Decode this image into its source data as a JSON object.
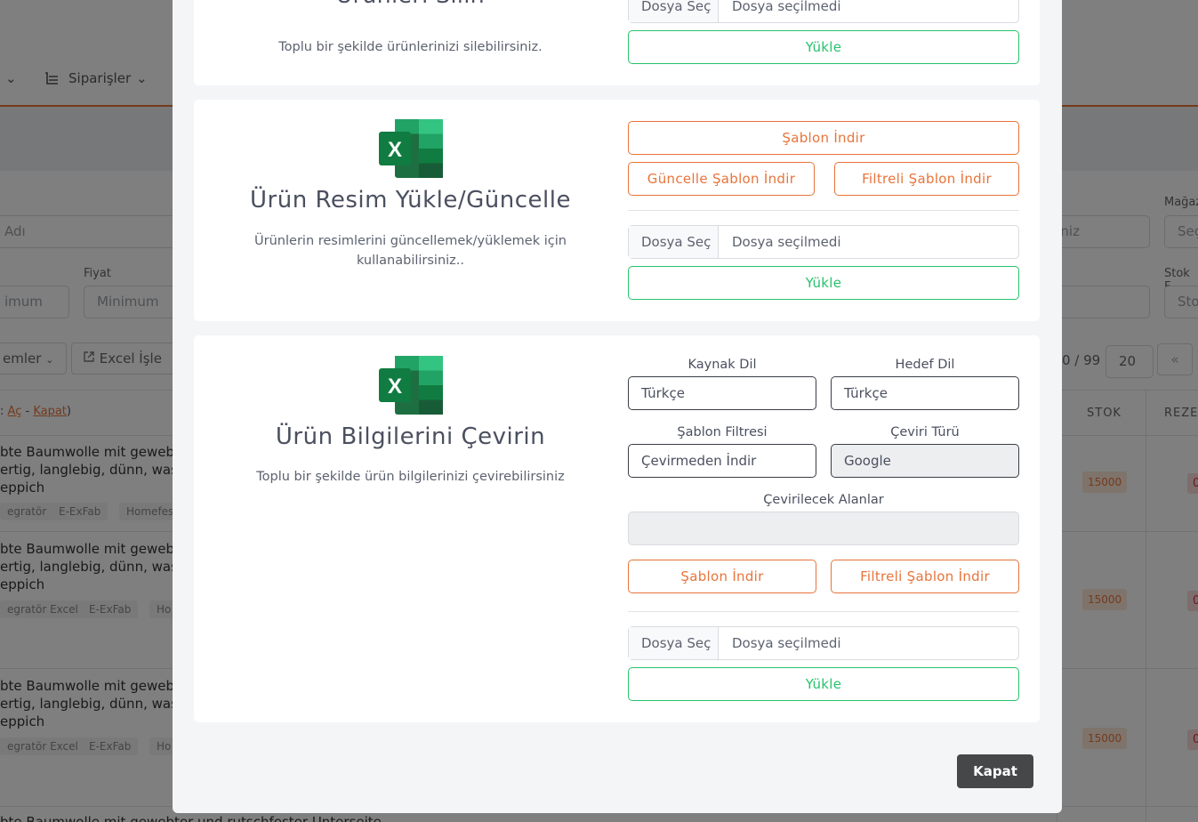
{
  "background": {
    "nav": {
      "orders_label": "Siparişler"
    },
    "filters": {
      "name_placeholder": "Adı",
      "price_label": "Fiyat",
      "min_placeholder_1": "imum",
      "min_placeholder_2": "Minimum",
      "right_placeholder": "çiniz",
      "store_label": "Mağaz",
      "store_value": "Seç",
      "stock_label": "Stok F",
      "stock_value": "Sto"
    },
    "toolbar": {
      "bulk_label": "emler",
      "excel_label": "Excel İşle",
      "page_info": "0 / 99",
      "page_size": "20"
    },
    "legend": {
      "prefix": ":",
      "open": "Aç",
      "sep": "-",
      "close": "Kapat",
      "suffix": ")"
    },
    "columns": {
      "stock": "STOK",
      "reserve": "REZE"
    },
    "rows": [
      {
        "line1": "bte Baumwolle mit gewebte",
        "line2": "ertig, langlebig, dünn, wasch",
        "line3": "eppich",
        "tags": [
          "egratör",
          "E-ExFab",
          "Homefes"
        ],
        "stock": "15000",
        "reserve": "0"
      },
      {
        "line1": "bte Baumwolle mit gewebte",
        "line2": "ertig, langlebig, dünn, wasch",
        "line3": "eppich",
        "tags": [
          "egratör Excel",
          "E-ExFab",
          "Ho"
        ],
        "stock": "15000",
        "reserve": "0"
      },
      {
        "line1": "bte Baumwolle mit gewebte",
        "line2": "ertig, langlebig, dünn, wasch",
        "line3": "eppich",
        "tags": [
          "egratör Excel",
          "E-ExFab",
          "Ho"
        ],
        "stock": "15000",
        "reserve": "0"
      }
    ],
    "last_row_text": "bte Baumwolle mit gewebter und rutschfester Unterseite"
  },
  "modal": {
    "delete_card": {
      "title": "Ürünleri Silin",
      "description": "Toplu bir şekilde ürünlerinizi silebilirsiniz.",
      "file_button": "Dosya Seç",
      "file_status": "Dosya seçilmedi",
      "upload_label": "Yükle"
    },
    "image_card": {
      "title": "Ürün Resim Yükle/Güncelle",
      "description": "Ürünlerin resimlerini güncellemek/yüklemek için kullanabilirsiniz..",
      "template_download": "Şablon İndir",
      "update_template_download": "Güncelle Şablon İndir",
      "filtered_template_download": "Filtreli Şablon İndir",
      "file_button": "Dosya Seç",
      "file_status": "Dosya seçilmedi",
      "upload_label": "Yükle"
    },
    "translate_card": {
      "title": "Ürün Bilgilerini Çevirin",
      "description": "Toplu bir şekilde ürün bilgilerinizi çevirebilirsiniz",
      "source_lang_label": "Kaynak Dil",
      "source_lang_value": "Türkçe",
      "target_lang_label": "Hedef Dil",
      "target_lang_value": "Türkçe",
      "template_filter_label": "Şablon Filtresi",
      "template_filter_value": "Çevirmeden İndir",
      "translation_type_label": "Çeviri Türü",
      "translation_type_value": "Google",
      "fields_label": "Çevirilecek Alanlar",
      "template_download": "Şablon İndir",
      "filtered_template_download": "Filtreli Şablon İndir",
      "file_button": "Dosya Seç",
      "file_status": "Dosya seçilmedi",
      "upload_label": "Yükle"
    },
    "close_label": "Kapat"
  },
  "colors": {
    "accent": "#e8743b",
    "success": "#27c26b",
    "excel_green": "#107c41",
    "dark_button": "#454749"
  },
  "icons": [
    "chevron-down-icon",
    "orders-icon",
    "external-link-icon",
    "excel-icon",
    "double-chevron-left-icon"
  ]
}
